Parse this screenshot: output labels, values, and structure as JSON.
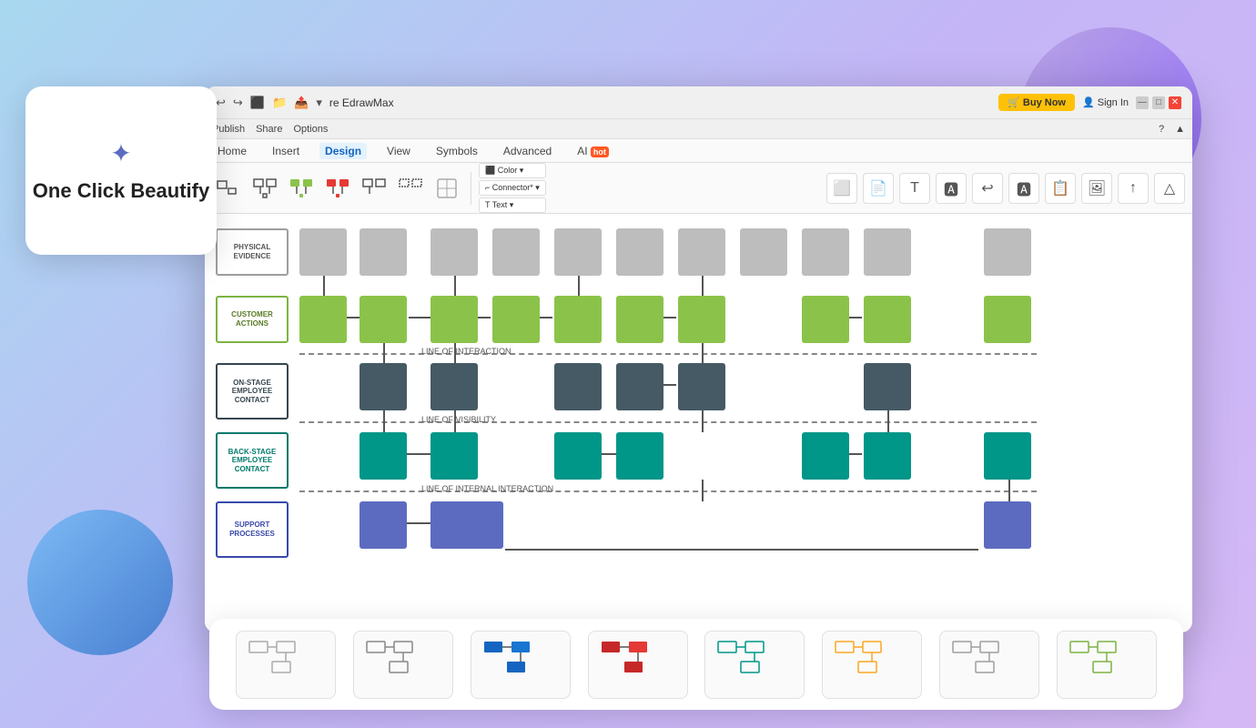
{
  "app": {
    "title": "re EdrawMax",
    "window_controls": [
      "minimize",
      "maximize",
      "close"
    ]
  },
  "feature_card": {
    "icon": "✦",
    "label": "One Click Beautify"
  },
  "toolbar": {
    "buy_now": "🛒 Buy Now",
    "sign_in": "Sign In",
    "publish": "Publish",
    "share": "Share",
    "options": "Options"
  },
  "menu": {
    "items": [
      "Home",
      "Insert",
      "Design",
      "View",
      "Symbols",
      "Advanced",
      "AI"
    ]
  },
  "ribbon": {
    "color_label": "Color",
    "connector_label": "Connector*",
    "text_label": "Text"
  },
  "diagram": {
    "rows": [
      {
        "id": "physical-evidence",
        "label": "PHYSICAL\nEVIDENCE",
        "color": "#bdbdbd",
        "border_color": "#9e9e9e"
      },
      {
        "id": "customer-actions",
        "label": "CUSTOMER\nACTIONS",
        "color": "#8bc34a",
        "border_color": "#7cb342"
      },
      {
        "id": "on-stage",
        "label": "ON-STAGE\nEMPLOYEE\nCONTACT",
        "color": "#455a64",
        "border_color": "#37474f"
      },
      {
        "id": "back-stage",
        "label": "BACK-STAGE\nEMPLOYEE\nCONTACT",
        "color": "#009688",
        "border_color": "#00796b"
      },
      {
        "id": "support",
        "label": "SUPPORT\nPROCESSES",
        "color": "#5c6bc0",
        "border_color": "#3949ab"
      }
    ],
    "lines": [
      "LINE OF INTERACTION",
      "LINE OF VISIBILITY",
      "LINE OF INTERNAL INTERACTION"
    ]
  },
  "templates": [
    "flowchart-basic",
    "flowchart-colored",
    "flowchart-blue",
    "flowchart-red",
    "flowchart-teal",
    "flowchart-yellow",
    "flowchart-outline",
    "flowchart-green-outline"
  ]
}
